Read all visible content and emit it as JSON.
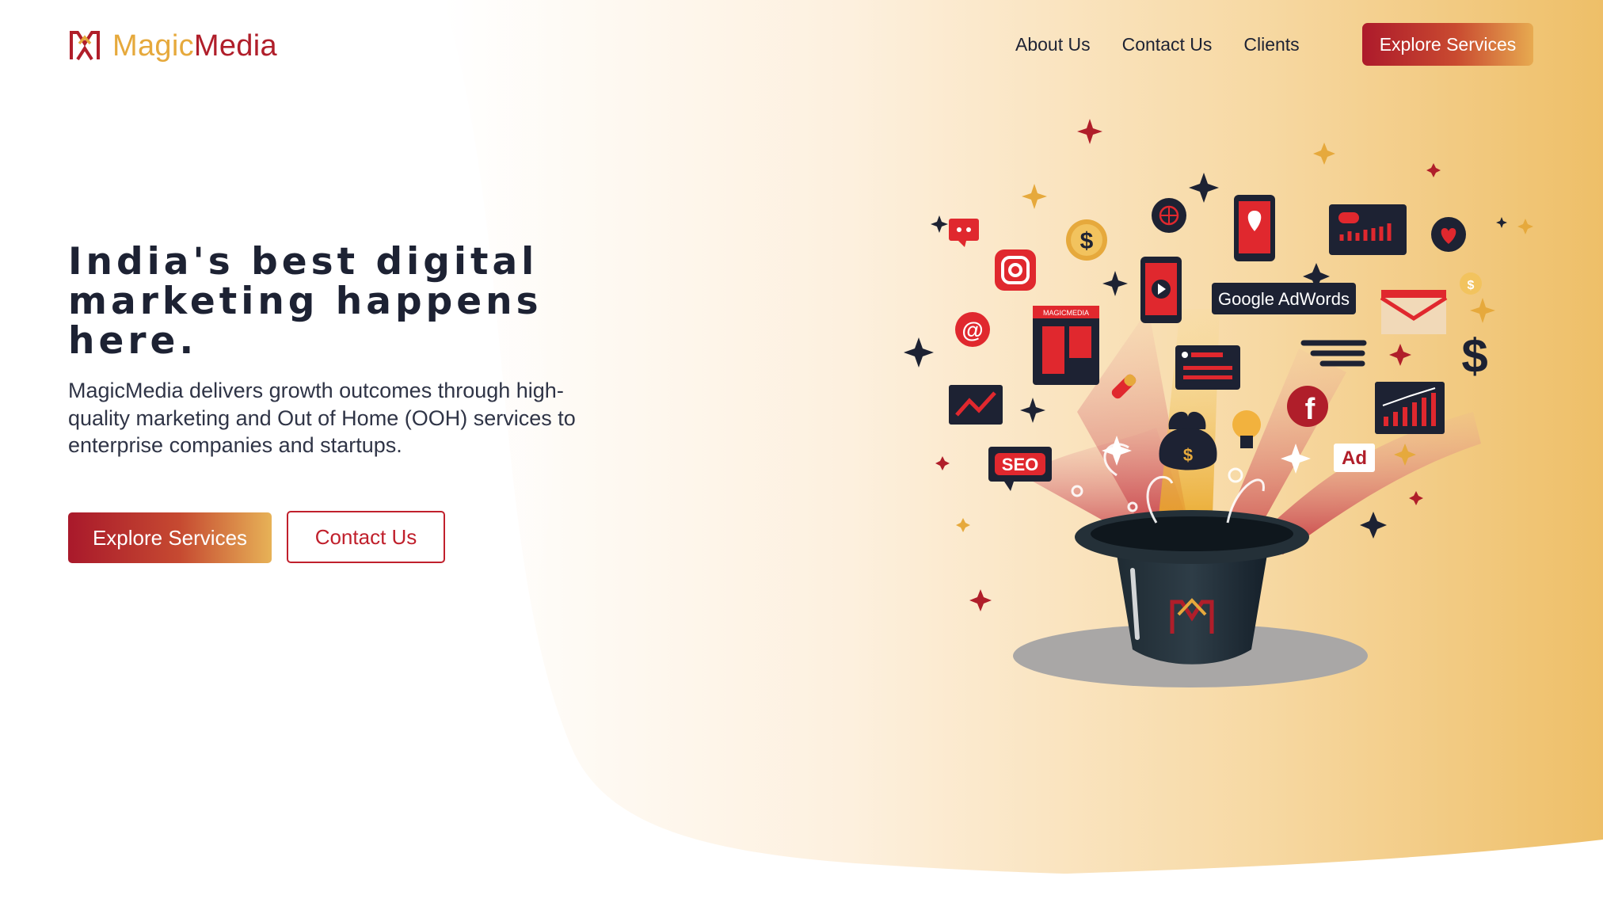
{
  "brand": {
    "name_part1": "Magic",
    "name_part2": "Media",
    "colors": {
      "accent_red": "#b01e2a",
      "accent_gold": "#e6a93c",
      "text_dark": "#1d2233"
    }
  },
  "nav": {
    "items": [
      {
        "label": "About Us"
      },
      {
        "label": "Contact Us"
      },
      {
        "label": "Clients"
      }
    ],
    "cta_label": "Explore Services"
  },
  "hero": {
    "title": "India's best digital marketing happens here.",
    "description": "MagicMedia delivers growth outcomes through high-quality marketing and Out of Home (OOH) services to enterprise companies and startups.",
    "primary_button": "Explore Services",
    "secondary_button": "Contact Us"
  },
  "illustration": {
    "icons": [
      "magic-hat-icon",
      "instagram-icon",
      "facebook-icon",
      "google-adwords-icon",
      "seo-icon",
      "ad-icon",
      "dollar-icon",
      "mail-icon",
      "phone-location-icon",
      "video-phone-icon",
      "chart-icon",
      "globe-icon",
      "heart-icon",
      "money-bag-icon",
      "lightbulb-icon",
      "at-sign-icon",
      "chat-icon",
      "sparkle-icon"
    ],
    "labels": {
      "adwords": "Google AdWords",
      "seo": "SEO",
      "ad": "Ad",
      "badge": "MAGICMEDIA",
      "dollar": "$"
    }
  }
}
